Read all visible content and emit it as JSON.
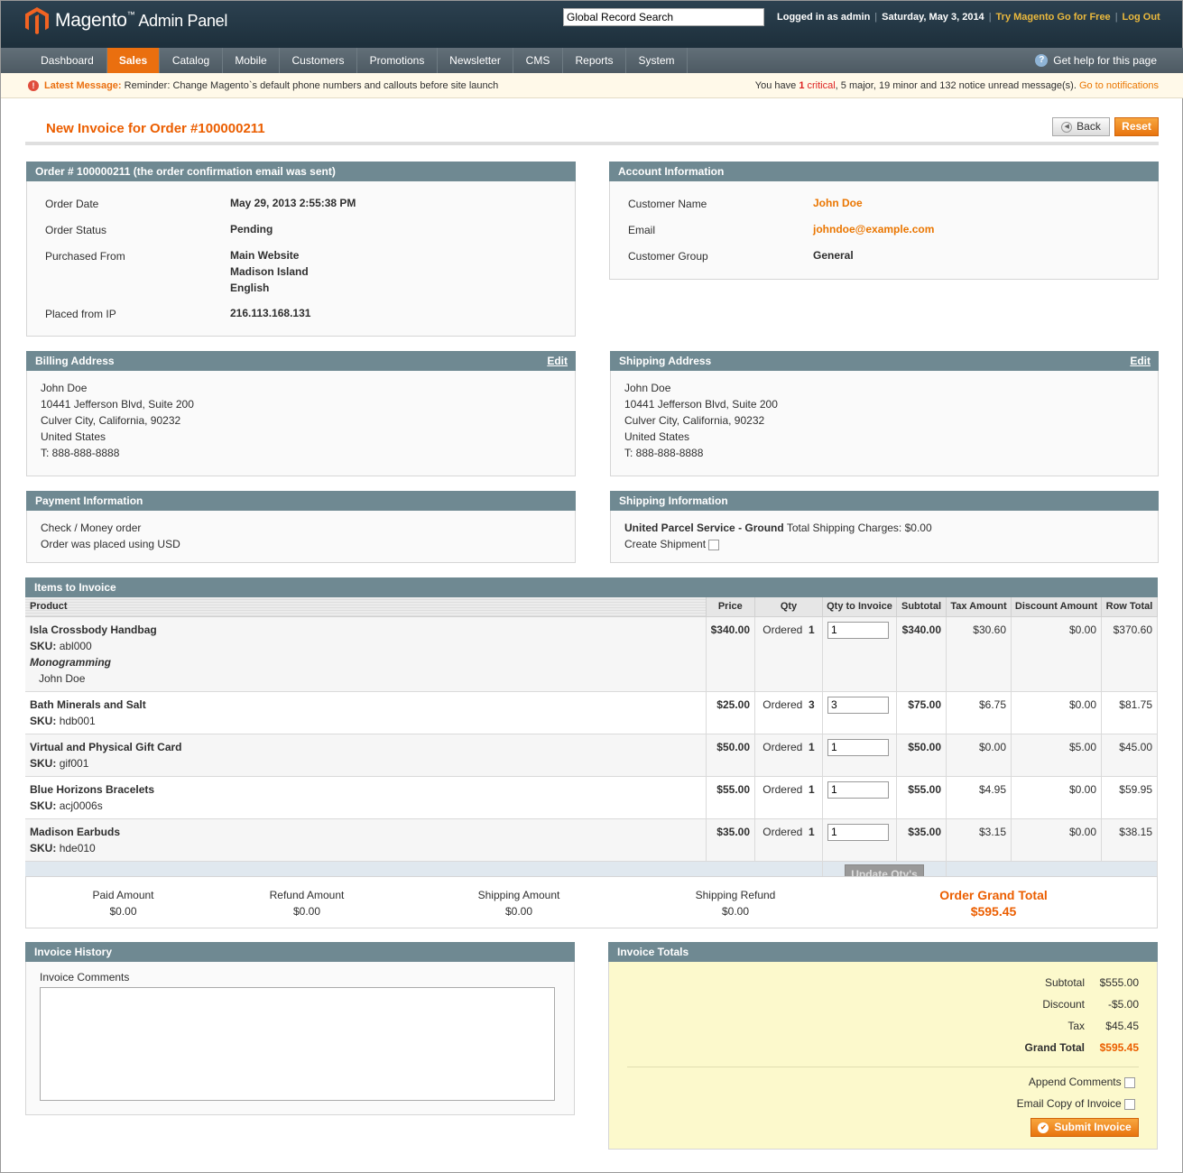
{
  "header": {
    "logo_text": "Magento",
    "logo_tm": "™",
    "logo_sub": "Admin Panel",
    "search_value": "Global Record Search",
    "logged_in": "Logged in as admin",
    "date": "Saturday, May 3, 2014",
    "try_link": "Try Magento Go for Free",
    "logout": "Log Out"
  },
  "nav": {
    "items": [
      "Dashboard",
      "Sales",
      "Catalog",
      "Mobile",
      "Customers",
      "Promotions",
      "Newsletter",
      "CMS",
      "Reports",
      "System"
    ],
    "active": "Sales",
    "help": "Get help for this page"
  },
  "message": {
    "label": "Latest Message:",
    "text": "Reminder: Change Magento`s default phone numbers and callouts before site launch",
    "count_prefix": "You have",
    "critical_count": "1",
    "critical_label": "critical",
    "rest": ", 5 major, 19 minor and 132 notice unread message(s).",
    "link": "Go to notifications"
  },
  "page": {
    "title": "New Invoice for Order #100000211",
    "back": "Back",
    "reset": "Reset"
  },
  "order": {
    "head_link": "Order # 100000211",
    "head_rest": "(the order confirmation email was sent)",
    "date_label": "Order Date",
    "date": "May 29, 2013 2:55:38 PM",
    "status_label": "Order Status",
    "status": "Pending",
    "from_label": "Purchased From",
    "from": [
      "Main Website",
      "Madison Island",
      "English"
    ],
    "ip_label": "Placed from IP",
    "ip": "216.113.168.131"
  },
  "account": {
    "head": "Account Information",
    "name_label": "Customer Name",
    "name": "John Doe",
    "email_label": "Email",
    "email": "johndoe@example.com",
    "group_label": "Customer Group",
    "group": "General"
  },
  "billing": {
    "head": "Billing Address",
    "edit": "Edit",
    "lines": [
      "John Doe",
      "10441 Jefferson Blvd, Suite 200",
      "Culver City, California, 90232",
      "United States",
      "T: 888-888-8888"
    ]
  },
  "shipping_addr": {
    "head": "Shipping Address",
    "edit": "Edit",
    "lines": [
      "John Doe",
      "10441 Jefferson Blvd, Suite 200",
      "Culver City, California, 90232",
      "United States",
      "T: 888-888-8888"
    ]
  },
  "payment": {
    "head": "Payment Information",
    "lines": [
      "Check / Money order",
      "Order was placed using USD"
    ]
  },
  "shipping_info": {
    "head": "Shipping Information",
    "method": "United Parcel Service - Ground",
    "charges": "Total Shipping Charges: $0.00",
    "create": "Create Shipment"
  },
  "items": {
    "head": "Items to Invoice",
    "columns": [
      "Product",
      "Price",
      "Qty",
      "Qty to Invoice",
      "Subtotal",
      "Tax Amount",
      "Discount Amount",
      "Row Total"
    ],
    "sku_label": "SKU:",
    "ordered_label": "Ordered",
    "rows": [
      {
        "name": "Isla Crossbody Handbag",
        "sku": "abl000",
        "option_label": "Monogramming",
        "option_value": "John Doe",
        "price": "$340.00",
        "qty": "1",
        "qty_invoice": "1",
        "subtotal": "$340.00",
        "tax": "$30.60",
        "discount": "$0.00",
        "row_total": "$370.60"
      },
      {
        "name": "Bath Minerals and Salt",
        "sku": "hdb001",
        "price": "$25.00",
        "qty": "3",
        "qty_invoice": "3",
        "subtotal": "$75.00",
        "tax": "$6.75",
        "discount": "$0.00",
        "row_total": "$81.75"
      },
      {
        "name": "Virtual and Physical Gift Card",
        "sku": "gif001",
        "price": "$50.00",
        "qty": "1",
        "qty_invoice": "1",
        "subtotal": "$50.00",
        "tax": "$0.00",
        "discount": "$5.00",
        "row_total": "$45.00"
      },
      {
        "name": "Blue Horizons Bracelets",
        "sku": "acj0006s",
        "price": "$55.00",
        "qty": "1",
        "qty_invoice": "1",
        "subtotal": "$55.00",
        "tax": "$4.95",
        "discount": "$0.00",
        "row_total": "$59.95"
      },
      {
        "name": "Madison Earbuds",
        "sku": "hde010",
        "price": "$35.00",
        "qty": "1",
        "qty_invoice": "1",
        "subtotal": "$35.00",
        "tax": "$3.15",
        "discount": "$0.00",
        "row_total": "$38.15"
      }
    ],
    "update_button": "Update Qty's"
  },
  "summary": {
    "paid_label": "Paid Amount",
    "paid": "$0.00",
    "refund_label": "Refund Amount",
    "refund": "$0.00",
    "ship_label": "Shipping Amount",
    "ship": "$0.00",
    "ship_refund_label": "Shipping Refund",
    "ship_refund": "$0.00",
    "grand_label": "Order Grand Total",
    "grand": "$595.45"
  },
  "history": {
    "head": "Invoice History",
    "comments_label": "Invoice Comments"
  },
  "totals": {
    "head": "Invoice Totals",
    "subtotal_label": "Subtotal",
    "subtotal": "$555.00",
    "discount_label": "Discount",
    "discount": "-$5.00",
    "tax_label": "Tax",
    "tax": "$45.45",
    "grand_label": "Grand Total",
    "grand": "$595.45",
    "append": "Append Comments",
    "email_copy": "Email Copy of Invoice",
    "submit": "Submit Invoice"
  }
}
